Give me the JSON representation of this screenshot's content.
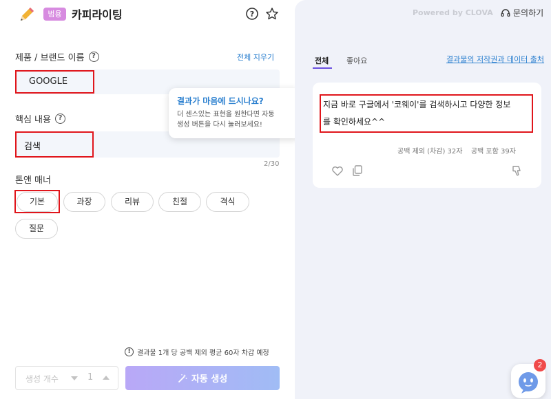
{
  "header": {
    "badge": "범용",
    "title": "카피라이팅",
    "icons": [
      "pencil-icon",
      "question-icon",
      "star-icon"
    ]
  },
  "form": {
    "product_label": "제품 / 브랜드 이름",
    "clear_all": "전체 지우기",
    "product_value": "GOOGLE",
    "core_label": "핵심 내용",
    "core_value": "검색",
    "counter": "2/30",
    "tone_label": "톤앤 매너",
    "tones": [
      "기본",
      "과장",
      "리뷰",
      "친절",
      "격식",
      "질문"
    ],
    "selected_tone": "기본"
  },
  "tooltip": {
    "title": "결과가 마음에 드시나요?",
    "body_line1": "더 센스있는 표현을 원한다면 자동",
    "body_line2": "생성 버튼을 다시 눌러보세요!"
  },
  "footer": {
    "notice": "결과물 1개 당 공백 제외 평균 60자 차감 예정",
    "stepper_label": "생성 개수",
    "stepper_value": "1",
    "generate_label": "자동 생성"
  },
  "right": {
    "powered": "Powered by CLOVA",
    "help": "문의하기",
    "tabs": [
      "전체",
      "좋아요"
    ],
    "copyright_link": "결과물의 저작권과 데이터 출처",
    "result_line1": "지금 바로 구글에서 '코웨이'를 검색하시고 다양한 정보",
    "result_line2": "를 확인하세요^^",
    "count_excluding": "공백 제외 (차감) 32자",
    "count_including": "공백 포함 39자",
    "chat_badge": "2"
  },
  "colors": {
    "accent_blue": "#2a7fcf",
    "highlight_red": "#e0151b",
    "badge_purple": "#d78be0",
    "tab_underline": "#6a4fe0"
  }
}
